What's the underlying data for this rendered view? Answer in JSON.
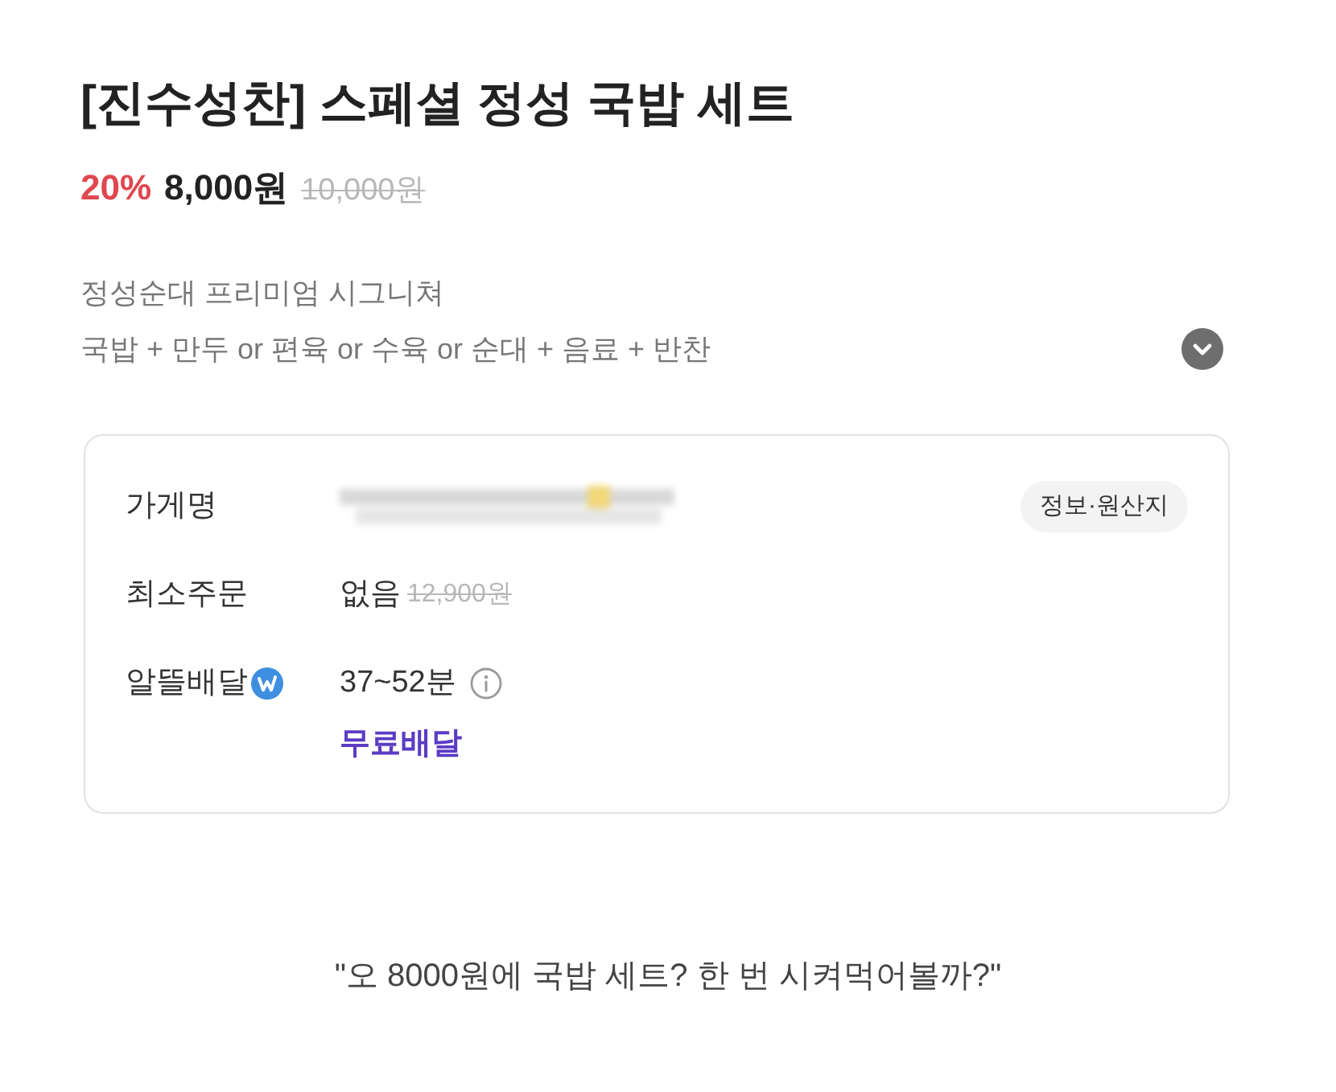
{
  "product": {
    "title": "[진수성찬] 스페셜 정성 국밥 세트",
    "discount": "20%",
    "price": "8,000원",
    "original_price": "10,000원"
  },
  "description": {
    "tagline": "정성순대 프리미엄 시그니쳐",
    "composition": "국밥 + 만두 or 편육 or 수육 or 순대 + 음료 + 반찬",
    "expanded": false
  },
  "store_info": {
    "info_button": "정보·원산지",
    "rows": [
      {
        "kind": "name",
        "label": "가게명"
      },
      {
        "kind": "min_order",
        "label": "최소주문",
        "value": "없음",
        "struck_value": "12,900원"
      },
      {
        "kind": "delivery",
        "label": "알뜰배달",
        "value": "37~52분",
        "note": "무료배달"
      }
    ]
  },
  "caption": "\"오 8000원에 국밥 세트? 한 번 시켜먹어볼까?\""
}
